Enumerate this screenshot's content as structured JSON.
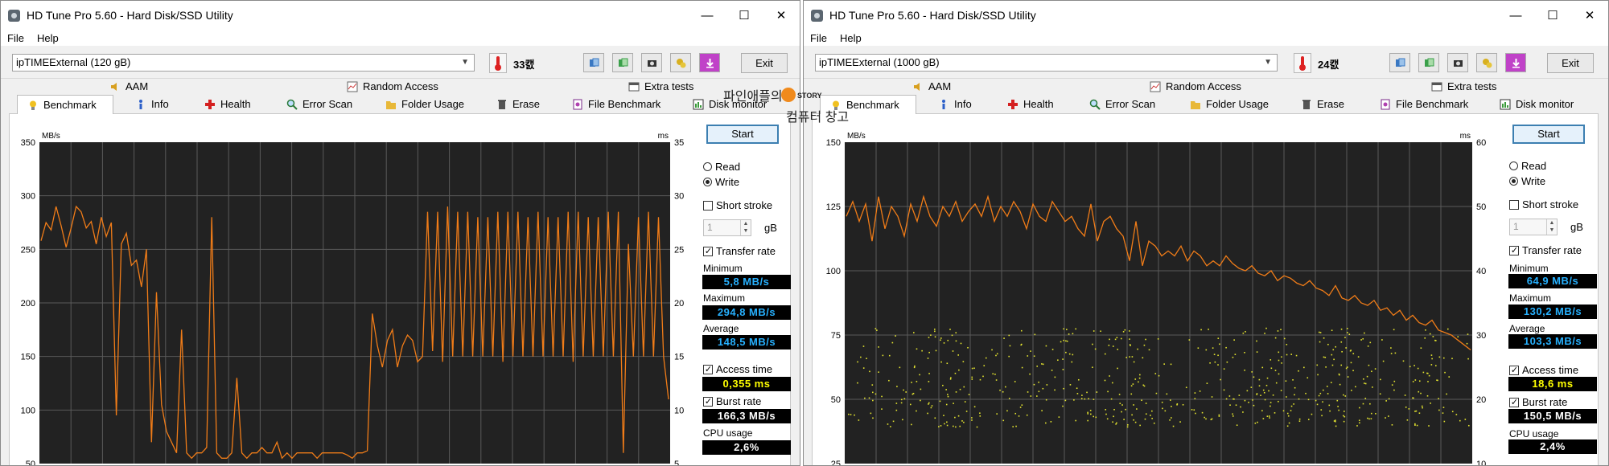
{
  "left_window": {
    "title": "HD Tune Pro 5.60 - Hard Disk/SSD Utility",
    "menu": [
      "File",
      "Help"
    ],
    "drive": "ipTIMEExternal (120 gB)",
    "temperature": "33캜",
    "exit_label": "Exit",
    "tabs_top": [
      "AAM",
      "Random Access",
      "Extra tests"
    ],
    "tabs_bottom": [
      "Benchmark",
      "Info",
      "Health",
      "Error Scan",
      "Folder Usage",
      "Erase",
      "File Benchmark",
      "Disk monitor"
    ],
    "active_tab": "Benchmark",
    "panel": {
      "start": "Start",
      "read": "Read",
      "write": "Write",
      "short_stroke": "Short stroke",
      "short_stroke_value": "1",
      "short_stroke_unit": "gB",
      "transfer_rate": "Transfer rate",
      "minimum_label": "Minimum",
      "minimum": "5,8 MB/s",
      "maximum_label": "Maximum",
      "maximum": "294,8 MB/s",
      "average_label": "Average",
      "average": "148,5 MB/s",
      "access_time_label": "Access time",
      "access_time": "0,355 ms",
      "burst_rate_label": "Burst rate",
      "burst_rate": "166,3 MB/s",
      "cpu_usage_label": "CPU usage",
      "cpu_usage": "2,6%"
    }
  },
  "right_window": {
    "title": "HD Tune Pro 5.60 - Hard Disk/SSD Utility",
    "menu": [
      "File",
      "Help"
    ],
    "drive": "ipTIMEExternal (1000 gB)",
    "temperature": "24캜",
    "exit_label": "Exit",
    "tabs_top": [
      "AAM",
      "Random Access",
      "Extra tests"
    ],
    "tabs_bottom": [
      "Benchmark",
      "Info",
      "Health",
      "Error Scan",
      "Folder Usage",
      "Erase",
      "File Benchmark",
      "Disk monitor"
    ],
    "active_tab": "Benchmark",
    "panel": {
      "start": "Start",
      "read": "Read",
      "write": "Write",
      "short_stroke": "Short stroke",
      "short_stroke_value": "1",
      "short_stroke_unit": "gB",
      "transfer_rate": "Transfer rate",
      "minimum_label": "Minimum",
      "minimum": "64,9 MB/s",
      "maximum_label": "Maximum",
      "maximum": "130,2 MB/s",
      "average_label": "Average",
      "average": "103,3 MB/s",
      "access_time_label": "Access time",
      "access_time": "18,6 ms",
      "burst_rate_label": "Burst rate",
      "burst_rate": "150,5 MB/s",
      "cpu_usage_label": "CPU usage",
      "cpu_usage": "2,4%"
    }
  },
  "watermark": {
    "line1": "파인애플의",
    "logo": "STORY",
    "line2": "컴퓨터 창고"
  },
  "colors": {
    "line": "#f07c18",
    "dots": "#e4e430",
    "plot_bg": "#222222",
    "grid": "#5a5a5a",
    "value_blue": "#27b1ff",
    "value_yellow": "#ffff00"
  },
  "chart_data": [
    {
      "type": "line",
      "window": "left",
      "left_axis_unit": "MB/s",
      "right_axis_unit": "ms",
      "left_ticks": [
        "350",
        "300",
        "250",
        "200",
        "150",
        "100",
        "50"
      ],
      "right_ticks": [
        "35",
        "30",
        "25",
        "20",
        "15",
        "10",
        "5"
      ],
      "ylim": [
        50,
        350
      ],
      "ylim_right": [
        5,
        35
      ],
      "transfer_rate_mbps": [
        258,
        275,
        268,
        290,
        272,
        252,
        270,
        290,
        285,
        270,
        276,
        255,
        280,
        262,
        275,
        95,
        255,
        265,
        235,
        240,
        215,
        250,
        70,
        210,
        105,
        80,
        70,
        60,
        175,
        60,
        55,
        60,
        60,
        65,
        280,
        60,
        55,
        55,
        60,
        130,
        60,
        55,
        60,
        60,
        65,
        60,
        60,
        70,
        55,
        60,
        55,
        60,
        60,
        60,
        60,
        55,
        60,
        60,
        60,
        60,
        60,
        58,
        55,
        60,
        60,
        62,
        190,
        160,
        140,
        165,
        175,
        140,
        160,
        170,
        165,
        145,
        150,
        285,
        155,
        285,
        145,
        290,
        150,
        285,
        150,
        285,
        150,
        280,
        150,
        280,
        150,
        285,
        145,
        285,
        150,
        285,
        150,
        280,
        150,
        285,
        150,
        280,
        150,
        280,
        150,
        285,
        145,
        285,
        150,
        280,
        150,
        280,
        150,
        285,
        150,
        285,
        60,
        255,
        150,
        280,
        150,
        285,
        150,
        280,
        150,
        110
      ],
      "access_time_ms": []
    },
    {
      "type": "line",
      "window": "right",
      "left_axis_unit": "MB/s",
      "right_axis_unit": "ms",
      "left_ticks": [
        "150",
        "125",
        "100",
        "75",
        "50",
        "25"
      ],
      "right_ticks": [
        "60",
        "50",
        "40",
        "30",
        "20",
        "10"
      ],
      "ylim": [
        20,
        150
      ],
      "ylim_right": [
        8,
        60
      ],
      "transfer_rate_mbps": [
        120,
        126,
        118,
        125,
        110,
        128,
        115,
        124,
        120,
        112,
        125,
        118,
        128,
        120,
        116,
        124,
        120,
        126,
        118,
        122,
        125,
        120,
        128,
        118,
        124,
        120,
        126,
        122,
        115,
        125,
        120,
        118,
        126,
        122,
        118,
        120,
        115,
        112,
        125,
        110,
        118,
        120,
        115,
        112,
        102,
        118,
        100,
        110,
        108,
        104,
        106,
        104,
        108,
        102,
        106,
        104,
        100,
        102,
        100,
        104,
        101,
        99,
        98,
        100,
        97,
        96,
        98,
        94,
        96,
        95,
        93,
        92,
        94,
        91,
        90,
        88,
        92,
        87,
        86,
        88,
        85,
        84,
        86,
        82,
        83,
        80,
        82,
        78,
        80,
        77,
        76,
        78,
        74,
        73,
        72,
        70,
        68,
        66
      ],
      "access_time_ms": "scatter cluster between 11 and 30 ms"
    }
  ]
}
